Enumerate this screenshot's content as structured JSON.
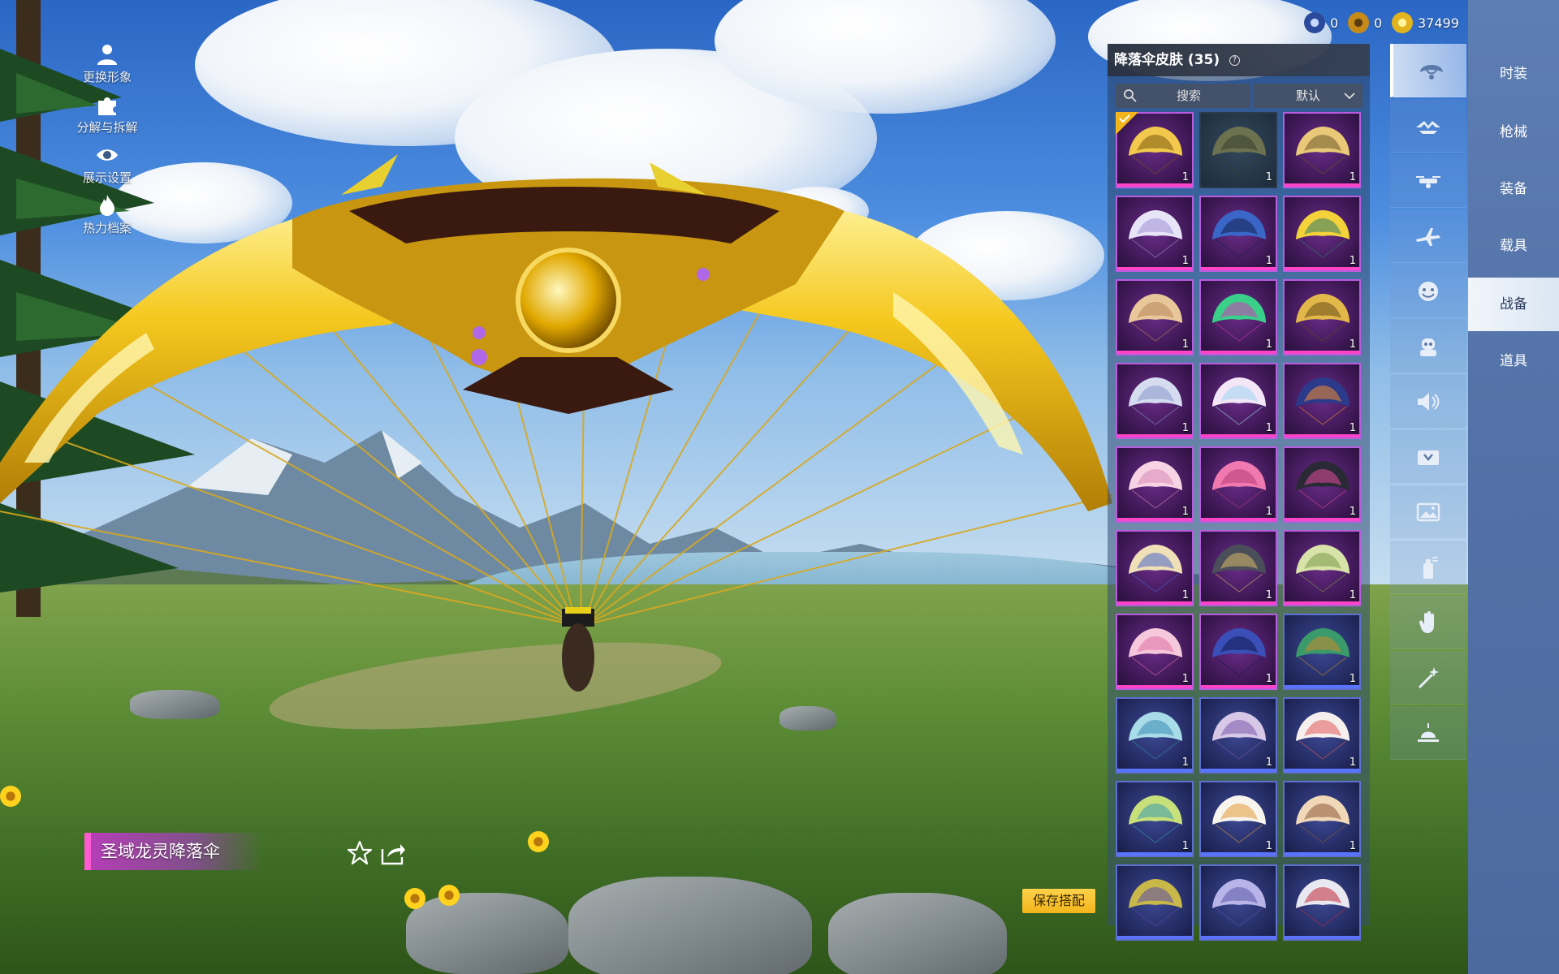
{
  "left_menu": [
    {
      "label": "更换形象",
      "icon": "person-icon"
    },
    {
      "label": "分解与拆解",
      "icon": "puzzle-icon"
    },
    {
      "label": "展示设置",
      "icon": "eye-icon"
    },
    {
      "label": "热力档案",
      "icon": "flame-icon"
    }
  ],
  "currency": [
    {
      "icon": "bp-coin-icon",
      "value": "0",
      "color": "#2b4a9c"
    },
    {
      "icon": "silver-coin-icon",
      "value": "0",
      "color": "#c58a18"
    },
    {
      "icon": "uc-coin-icon",
      "value": "37499",
      "color": "#e2b41f"
    }
  ],
  "panel": {
    "title": "降落伞皮肤",
    "count": "(35)",
    "help": "?",
    "search_placeholder": "搜索",
    "sort_label": "默认"
  },
  "item_name": "圣域龙灵降落伞",
  "save_label": "保存搭配",
  "items": [
    {
      "qty": "1",
      "rarity": "purple",
      "equipped": true,
      "c1": "#f2c94c",
      "c2": "#7a5a10"
    },
    {
      "qty": "1",
      "rarity": "dark",
      "c1": "#6c7150",
      "c2": "#3b3f2a"
    },
    {
      "qty": "1",
      "rarity": "purple",
      "c1": "#e9c978",
      "c2": "#6d5a2c"
    },
    {
      "qty": "1",
      "rarity": "purple",
      "c1": "#e8e4f8",
      "c2": "#9d8fd6"
    },
    {
      "qty": "1",
      "rarity": "purple",
      "c1": "#3a66c8",
      "c2": "#14204e"
    },
    {
      "qty": "1",
      "rarity": "purple",
      "c1": "#f3d23a",
      "c2": "#2e7a6a"
    },
    {
      "qty": "1",
      "rarity": "purple",
      "c1": "#e8c79a",
      "c2": "#b5835a"
    },
    {
      "qty": "1",
      "rarity": "purple",
      "c1": "#3bd08a",
      "c2": "#d23bb4"
    },
    {
      "qty": "1",
      "rarity": "purple",
      "c1": "#e3b84a",
      "c2": "#6a4c16"
    },
    {
      "qty": "1",
      "rarity": "purple",
      "c1": "#d6dcf0",
      "c2": "#8a96c8"
    },
    {
      "qty": "1",
      "rarity": "purple",
      "c1": "#f3e6f7",
      "c2": "#9fd6f0"
    },
    {
      "qty": "1",
      "rarity": "purple",
      "c1": "#2c3a8c",
      "c2": "#f08a2a"
    },
    {
      "qty": "1",
      "rarity": "purple",
      "c1": "#f7d3e4",
      "c2": "#d98ab4"
    },
    {
      "qty": "1",
      "rarity": "purple",
      "c1": "#f07ab0",
      "c2": "#b83a76"
    },
    {
      "qty": "1",
      "rarity": "purple",
      "c1": "#2a2a36",
      "c2": "#e04a9a"
    },
    {
      "qty": "1",
      "rarity": "purple",
      "c1": "#f0e0b8",
      "c2": "#4a66c8"
    },
    {
      "qty": "1",
      "rarity": "purple",
      "c1": "#4a4e5a",
      "c2": "#d8b86a"
    },
    {
      "qty": "1",
      "rarity": "purple",
      "c1": "#d7e3a8",
      "c2": "#7c9a4a"
    },
    {
      "qty": "1",
      "rarity": "purple",
      "c1": "#f5c8dc",
      "c2": "#e070a6"
    },
    {
      "qty": "1",
      "rarity": "purple",
      "c1": "#3a4fb8",
      "c2": "#121a4e"
    },
    {
      "qty": "1",
      "rarity": "blue",
      "c1": "#3a9a6a",
      "c2": "#c88a2a"
    },
    {
      "qty": "1",
      "rarity": "blue",
      "c1": "#a8dce8",
      "c2": "#3a8ab0"
    },
    {
      "qty": "1",
      "rarity": "blue",
      "c1": "#d8c8e8",
      "c2": "#7a5aa8"
    },
    {
      "qty": "1",
      "rarity": "blue",
      "c1": "#f5f0ee",
      "c2": "#e05a5a"
    },
    {
      "qty": "1",
      "rarity": "blue",
      "c1": "#c8e07a",
      "c2": "#3a9ab0"
    },
    {
      "qty": "1",
      "rarity": "blue",
      "c1": "#f8f4ee",
      "c2": "#e09a3a"
    },
    {
      "qty": "1",
      "rarity": "blue",
      "c1": "#f0d8b8",
      "c2": "#8a5a3a"
    },
    {
      "qty": "",
      "rarity": "blue",
      "c1": "#c8b84a",
      "c2": "#5a4aa8"
    },
    {
      "qty": "",
      "rarity": "blue",
      "c1": "#b8b4e8",
      "c2": "#5a58a8"
    },
    {
      "qty": "",
      "rarity": "blue",
      "c1": "#e8e8f0",
      "c2": "#c02a3a"
    }
  ],
  "categories": [
    {
      "icon": "parachute-icon",
      "active": true
    },
    {
      "icon": "glider-icon"
    },
    {
      "icon": "drone-icon"
    },
    {
      "icon": "airplane-icon"
    },
    {
      "icon": "emote-face-icon"
    },
    {
      "icon": "companion-icon"
    },
    {
      "icon": "speaker-icon"
    },
    {
      "icon": "crate-icon"
    },
    {
      "icon": "picture-icon"
    },
    {
      "icon": "spray-icon"
    },
    {
      "icon": "gesture-hand-icon"
    },
    {
      "icon": "magic-wand-icon"
    },
    {
      "icon": "landing-icon"
    }
  ],
  "tabs": [
    {
      "label": "时装"
    },
    {
      "label": "枪械"
    },
    {
      "label": "装备"
    },
    {
      "label": "载具"
    },
    {
      "label": "战备",
      "active": true
    },
    {
      "label": "道具"
    }
  ]
}
